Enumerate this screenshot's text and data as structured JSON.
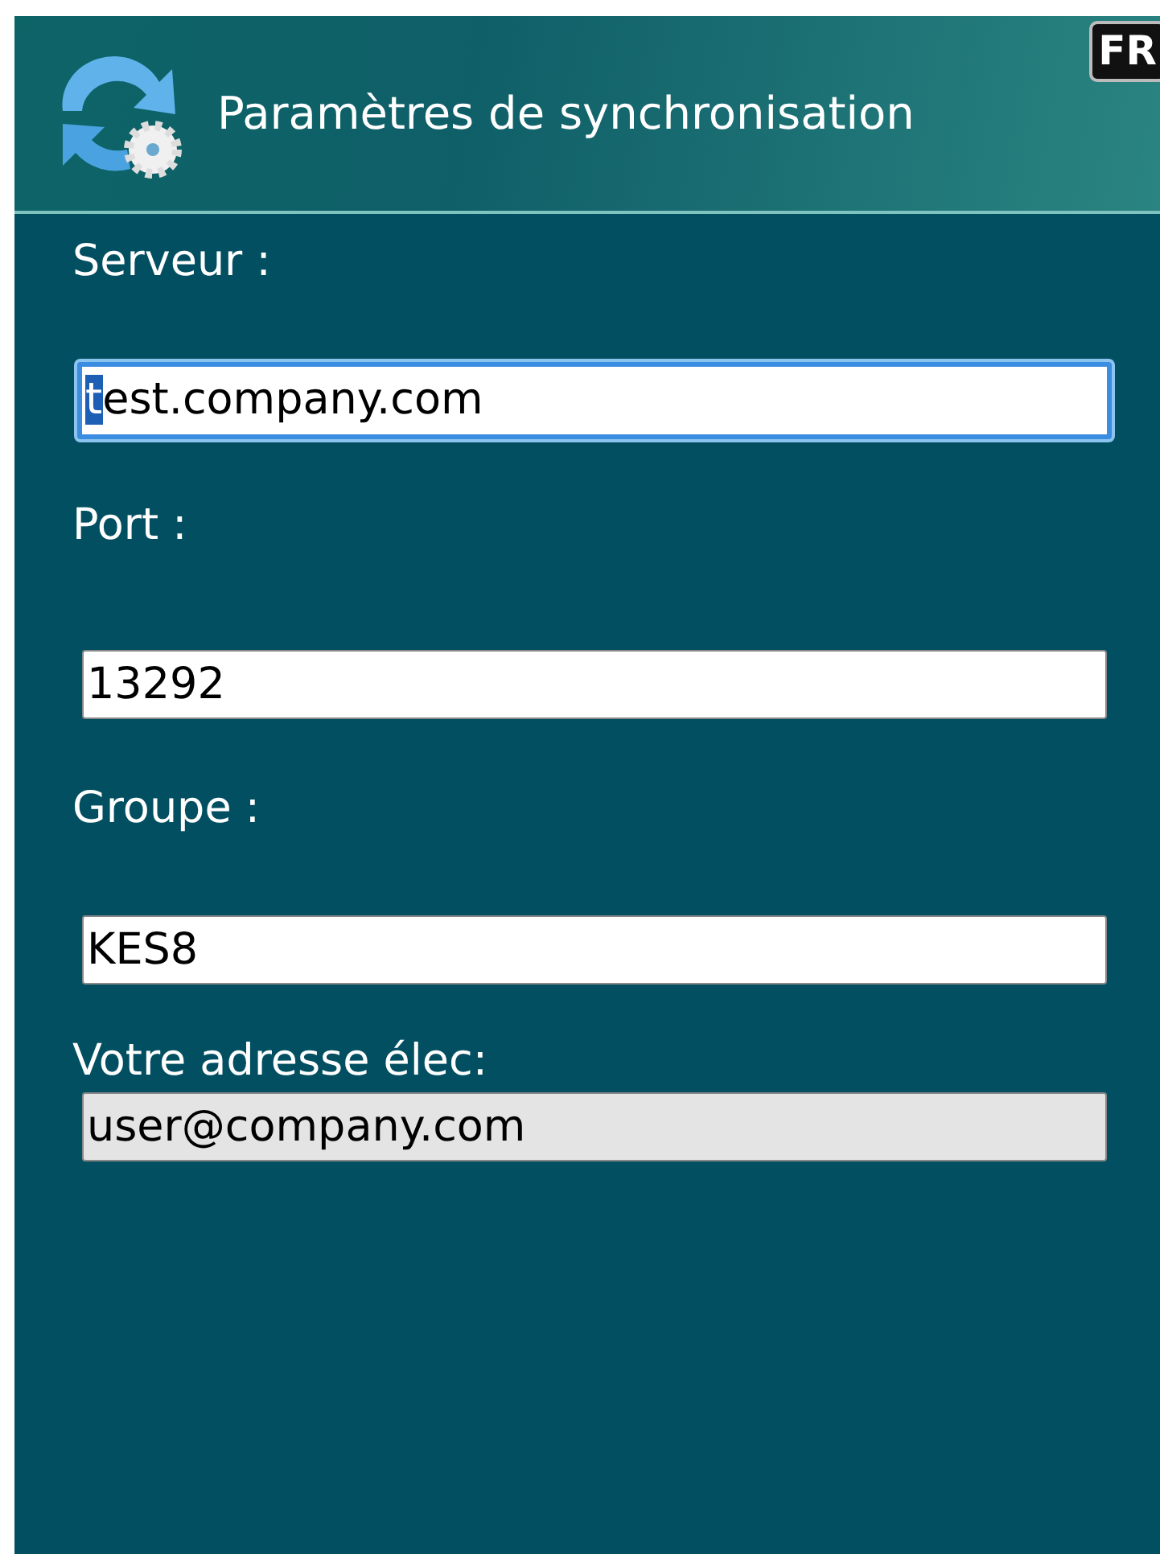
{
  "header": {
    "title": "Paramètres de synchronisation",
    "language_indicator": "FR"
  },
  "fields": [
    {
      "label": "Serveur :",
      "value": "test.company.com",
      "focused": true,
      "disabled": false
    },
    {
      "label": "Port :",
      "value": "13292",
      "focused": false,
      "disabled": false
    },
    {
      "label": "Groupe :",
      "value": "KES8",
      "focused": false,
      "disabled": false
    },
    {
      "label": "Votre adresse élec:",
      "value": "user@company.com",
      "focused": false,
      "disabled": true
    }
  ]
}
